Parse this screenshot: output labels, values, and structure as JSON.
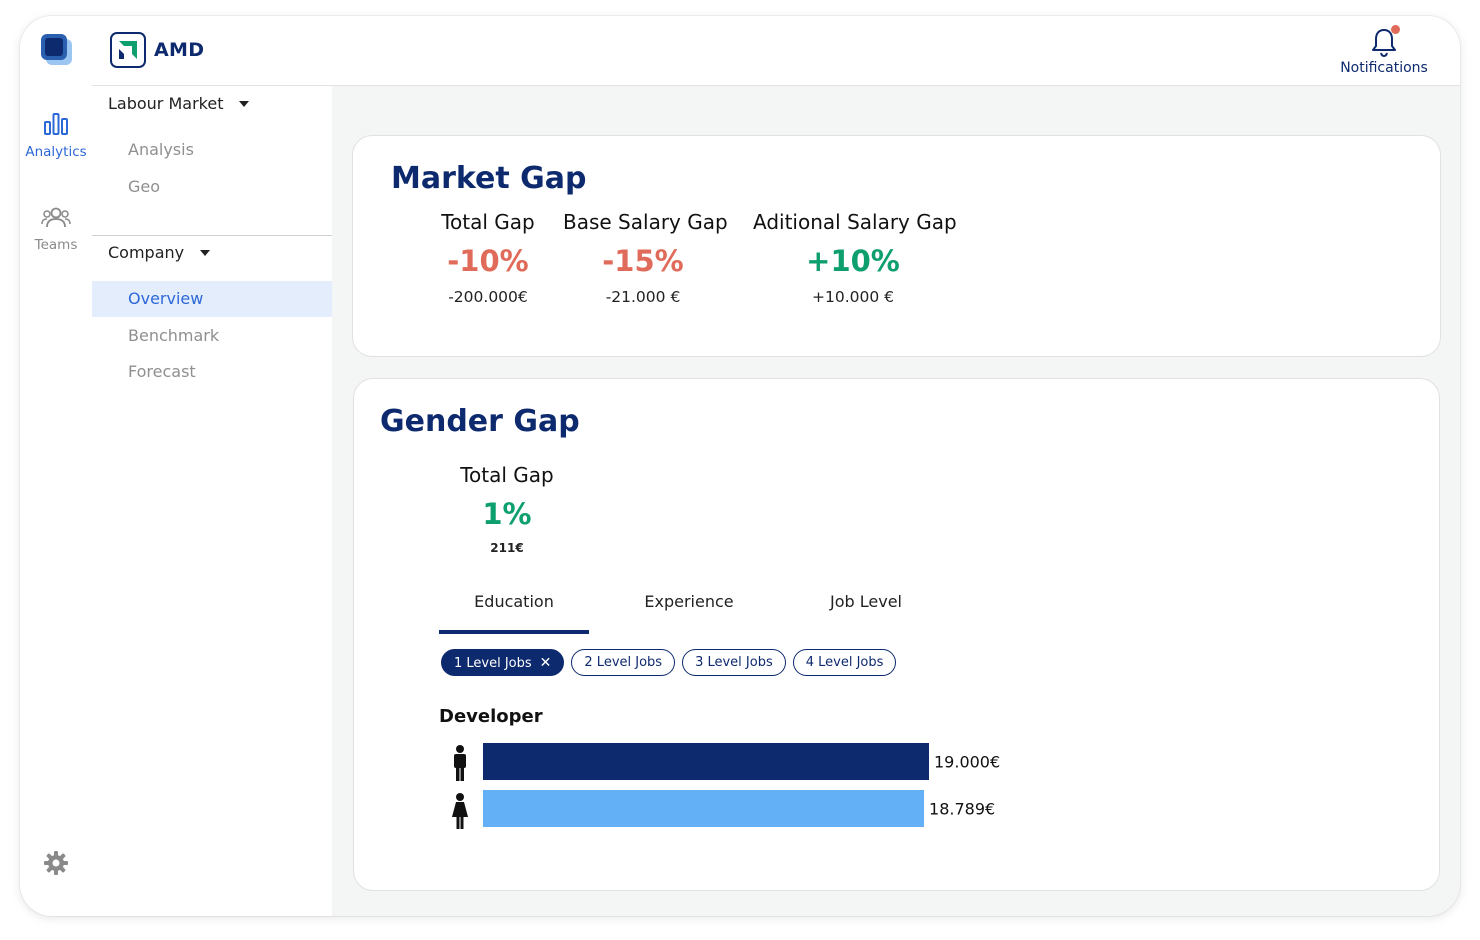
{
  "brand": {
    "name": "AMD"
  },
  "rail": {
    "items": [
      {
        "label": "Analytics",
        "icon": "bar-chart-icon",
        "active": true
      },
      {
        "label": "Teams",
        "icon": "users-icon",
        "active": false
      }
    ],
    "settings_icon": "gear-icon"
  },
  "topbar": {
    "notifications_label": "Notifications",
    "notification_badge": "!"
  },
  "subnav": {
    "groups": [
      {
        "label": "Labour Market",
        "items": [
          {
            "label": "Analysis"
          },
          {
            "label": "Geo"
          }
        ]
      },
      {
        "label": "Company",
        "items": [
          {
            "label": "Overview",
            "active": true
          },
          {
            "label": "Benchmark"
          },
          {
            "label": "Forecast"
          }
        ]
      }
    ]
  },
  "market_gap": {
    "title": "Market Gap",
    "metrics": [
      {
        "label": "Total Gap",
        "value": "-10%",
        "sub": "-200.000€"
      },
      {
        "label": "Base Salary Gap",
        "value": "-15%",
        "sub": "-21.000 €"
      },
      {
        "label": "Aditional Salary Gap",
        "value": "+10%",
        "sub": "+10.000 €"
      }
    ]
  },
  "gender_gap": {
    "title": "Gender Gap",
    "total": {
      "label": "Total Gap",
      "value": "1%",
      "sub": "211€"
    },
    "tabs": [
      {
        "label": "Education",
        "active": true
      },
      {
        "label": "Experience",
        "active": false
      },
      {
        "label": "Job Level",
        "active": false
      }
    ],
    "chips": [
      {
        "label": "1 Level Jobs",
        "active": true
      },
      {
        "label": "2 Level Jobs",
        "active": false
      },
      {
        "label": "3 Level Jobs",
        "active": false
      },
      {
        "label": "4 Level Jobs",
        "active": false
      }
    ]
  },
  "colors": {
    "navy": "#0e2a6e",
    "light_blue": "#64b0f7",
    "negative": "#e06b5a",
    "positive": "#0e9f6e",
    "active_link": "#2d68d8"
  },
  "chart_data": {
    "type": "bar",
    "orientation": "horizontal",
    "title": "Developer",
    "categories": [
      "male",
      "female"
    ],
    "values": [
      19000,
      18789
    ],
    "value_labels": [
      "19.000€",
      "18.789€"
    ],
    "colors": [
      "#0e2a6e",
      "#64b0f7"
    ],
    "xlim": [
      0,
      19000
    ]
  }
}
